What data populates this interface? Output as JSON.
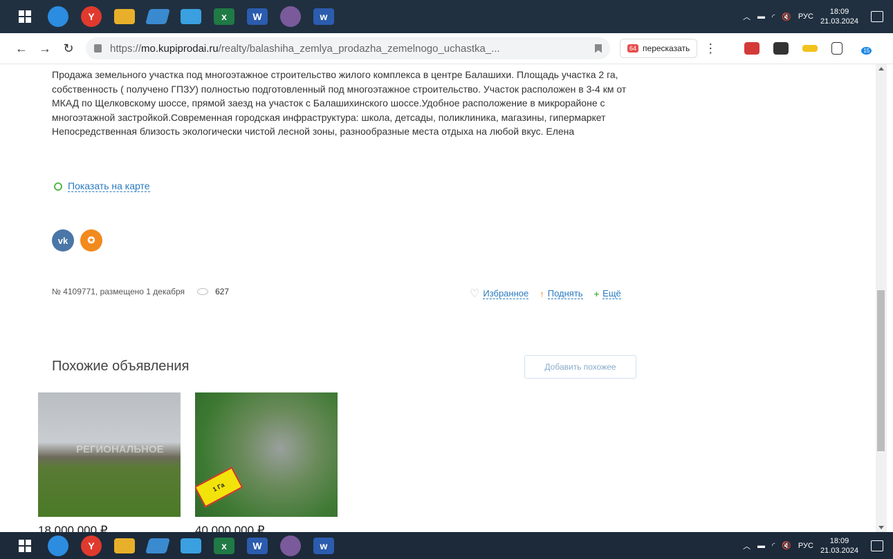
{
  "taskbar": {
    "apps": [
      {
        "name": "edge-icon",
        "color": "#2c8ce0",
        "glyph": ""
      },
      {
        "name": "yandex-browser-icon",
        "color": "#e03a2e",
        "glyph": "Y"
      },
      {
        "name": "file-explorer-icon",
        "color": "#e8b02a",
        "glyph": ""
      },
      {
        "name": "app-icon-notes",
        "color": "#3a8ad0",
        "glyph": ""
      },
      {
        "name": "photos-icon",
        "color": "#3aa0e0",
        "glyph": ""
      },
      {
        "name": "excel-icon",
        "color": "#1f7a45",
        "glyph": "x"
      },
      {
        "name": "word-icon-2",
        "color": "#2b5cae",
        "glyph": "W"
      },
      {
        "name": "paint-icon",
        "color": "#7a5a9a",
        "glyph": ""
      },
      {
        "name": "word-icon",
        "color": "#2b5cae",
        "glyph": "w"
      }
    ],
    "tray_lang": "РУС",
    "time": "18:09",
    "date": "21.03.2024"
  },
  "browser": {
    "url_scheme": "https://",
    "url_host": "mo.kupiprodai.ru",
    "url_path": "/realty/balashiha_zemlya_prodazha_zemelnogo_uchastka_...",
    "retell_label": "пересказать",
    "retell_badge": "64",
    "ext_badge_count": "15"
  },
  "listing": {
    "description": "Продажа земельного участка под многоэтажное строительство жилого комплекса в центре Балашихи. Площадь участка 2 га, собственность ( получено ГПЗУ) полностью подготовленный под многоэтажное строительство. Участок расположен в 3-4 км от МКАД по Щелковскому шоссе, прямой заезд на участок с Балашихинского шоссе.Удобное расположение в микрорайоне с многоэтажной застройкой.Современная городская инфраструктура: школа, детсады, поликлиника, магазины, гипермаркет",
    "description_2": "Непосредственная близость экологически чистой лесной зоны, разнообразные места отдыха на любой вкус. Елена",
    "map_link": "Показать на карте",
    "meta": "№ 4109771, размещено 1 декабря",
    "views": "627",
    "actions": {
      "favorite": "Избранное",
      "raise": "Поднять",
      "more": "Ещё"
    }
  },
  "social": {
    "vk": "vk",
    "ok": "ok"
  },
  "similar": {
    "title": "Похожие объявления",
    "add_button": "Добавить похожее",
    "cards": [
      {
        "price": "18 000 000 ₽",
        "watermark": "РЕГИОНАЛЬНОЕ"
      },
      {
        "price": "40 000 000 ₽",
        "lot_label": "1 Га"
      }
    ]
  }
}
